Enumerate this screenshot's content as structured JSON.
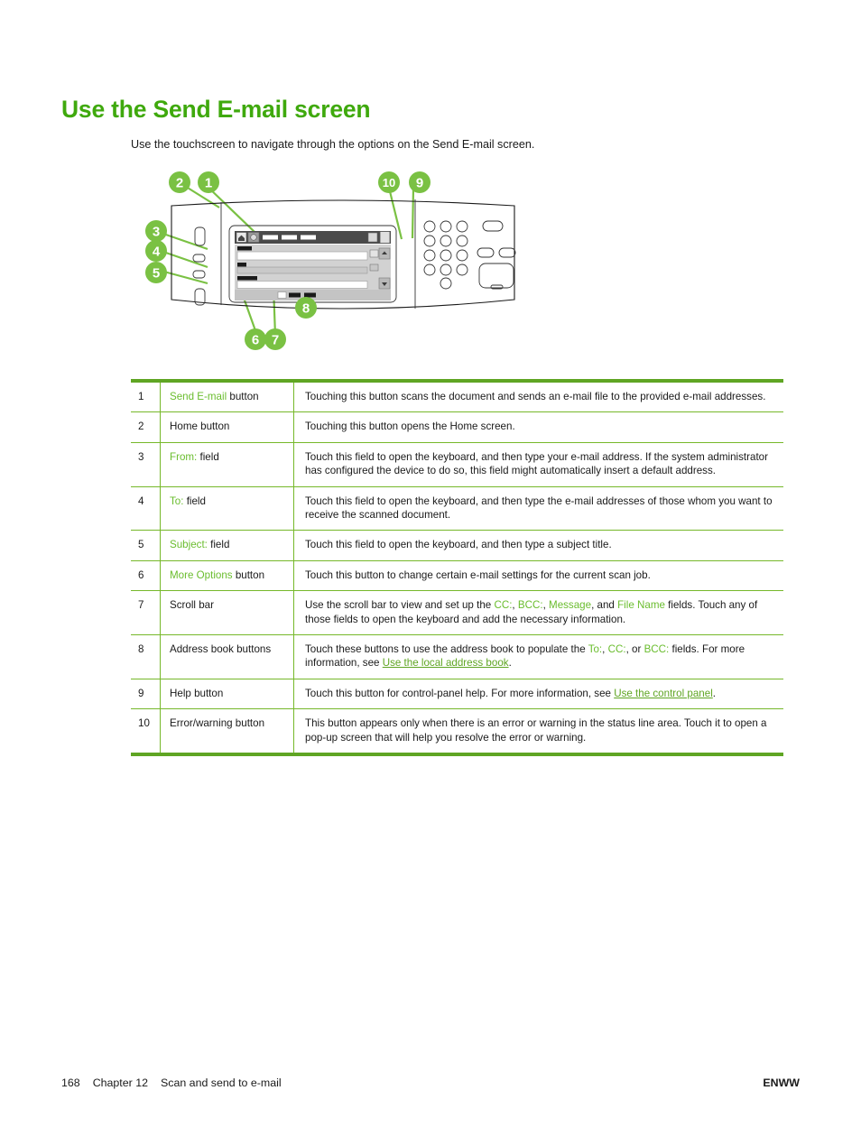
{
  "document": {
    "title": "Use the Send E-mail screen",
    "intro": "Use the touchscreen to navigate through the options on the Send E-mail screen."
  },
  "colors": {
    "heading_green": "#3FA90D",
    "accent_green": "#6ABD2E",
    "rule_green": "#5FA523",
    "link_green": "#5FA523",
    "callout_green": "#7AC143"
  },
  "figure": {
    "name": "control-panel-diagram",
    "callouts": [
      {
        "id": "1",
        "label": "1"
      },
      {
        "id": "2",
        "label": "2"
      },
      {
        "id": "3",
        "label": "3"
      },
      {
        "id": "4",
        "label": "4"
      },
      {
        "id": "5",
        "label": "5"
      },
      {
        "id": "6",
        "label": "6"
      },
      {
        "id": "7",
        "label": "7"
      },
      {
        "id": "8",
        "label": "8"
      },
      {
        "id": "9",
        "label": "9"
      },
      {
        "id": "10",
        "label": "10"
      }
    ]
  },
  "table": {
    "rows": [
      {
        "num": "1",
        "name_green": "Send E-mail",
        "name_rest": " button",
        "desc": "Touching this button scans the document and sends an e-mail file to the provided e-mail addresses."
      },
      {
        "num": "2",
        "name_green": "",
        "name_rest": "Home button",
        "desc": "Touching this button opens the Home screen."
      },
      {
        "num": "3",
        "name_green": "From:",
        "name_rest": " field",
        "desc": "Touch this field to open the keyboard, and then type your e-mail address. If the system administrator has configured the device to do so, this field might automatically insert a default address."
      },
      {
        "num": "4",
        "name_green": "To:",
        "name_rest": " field",
        "desc": "Touch this field to open the keyboard, and then type the e-mail addresses of those whom you want to receive the scanned document."
      },
      {
        "num": "5",
        "name_green": "Subject:",
        "name_rest": " field",
        "desc": "Touch this field to open the keyboard, and then type a subject title."
      },
      {
        "num": "6",
        "name_green": "More Options",
        "name_rest": " button",
        "desc": "Touch this button to change certain e-mail settings for the current scan job."
      },
      {
        "num": "7",
        "name_green": "",
        "name_rest": "Scroll bar",
        "desc_parts": [
          {
            "t": "Use the scroll bar to view and set up the ",
            "s": "plain"
          },
          {
            "t": "CC:",
            "s": "green"
          },
          {
            "t": ", ",
            "s": "plain"
          },
          {
            "t": "BCC:",
            "s": "green"
          },
          {
            "t": ", ",
            "s": "plain"
          },
          {
            "t": "Message",
            "s": "green"
          },
          {
            "t": ", and ",
            "s": "plain"
          },
          {
            "t": "File Name",
            "s": "green"
          },
          {
            "t": " fields. Touch any of those fields to open the keyboard and add the necessary information.",
            "s": "plain"
          }
        ]
      },
      {
        "num": "8",
        "name_green": "",
        "name_rest": "Address book buttons",
        "desc_parts": [
          {
            "t": "Touch these buttons to use the address book to populate the ",
            "s": "plain"
          },
          {
            "t": "To:",
            "s": "green"
          },
          {
            "t": ", ",
            "s": "plain"
          },
          {
            "t": "CC:",
            "s": "green"
          },
          {
            "t": ", or ",
            "s": "plain"
          },
          {
            "t": "BCC:",
            "s": "green"
          },
          {
            "t": " fields. For more information, see ",
            "s": "plain"
          },
          {
            "t": "Use the local address book",
            "s": "link"
          },
          {
            "t": ".",
            "s": "plain"
          }
        ]
      },
      {
        "num": "9",
        "name_green": "",
        "name_rest": "Help button",
        "desc_parts": [
          {
            "t": "Touch this button for control-panel help. For more information, see ",
            "s": "plain"
          },
          {
            "t": "Use the control panel",
            "s": "link"
          },
          {
            "t": ".",
            "s": "plain"
          }
        ]
      },
      {
        "num": "10",
        "name_green": "",
        "name_rest": "Error/warning button",
        "desc": "This button appears only when there is an error or warning in the status line area. Touch it to open a pop-up screen that will help you resolve the error or warning."
      }
    ]
  },
  "footer": {
    "page_number": "168",
    "chapter": "Chapter 12",
    "chapter_title": "Scan and send to e-mail",
    "right": "ENWW"
  }
}
